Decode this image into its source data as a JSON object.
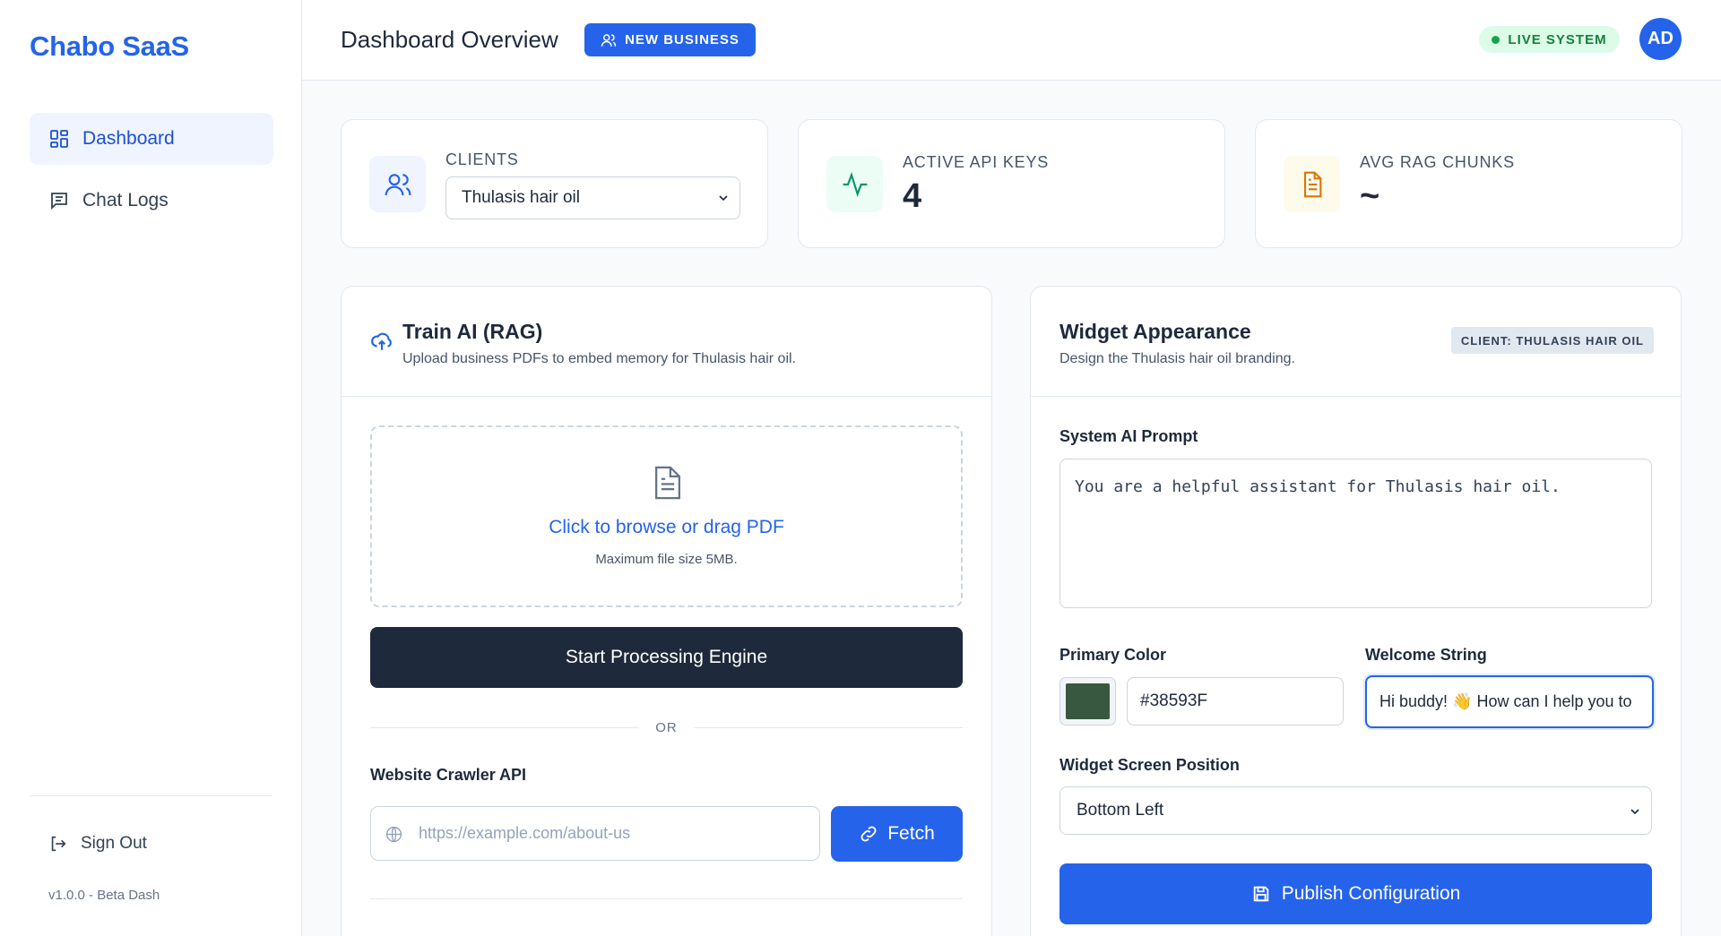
{
  "sidebar": {
    "brand": "Chabo SaaS",
    "items": [
      {
        "label": "Dashboard",
        "icon": "dashboard-grid-icon",
        "active": true
      },
      {
        "label": "Chat Logs",
        "icon": "chat-bubble-icon",
        "active": false
      }
    ],
    "signout_label": "Sign Out",
    "version": "v1.0.0 - Beta Dash"
  },
  "header": {
    "title": "Dashboard Overview",
    "new_business_label": "NEW BUSINESS",
    "status_label": "LIVE SYSTEM",
    "avatar_initials": "AD"
  },
  "stats": {
    "clients": {
      "label": "CLIENTS",
      "selected": "Thulasis hair oil"
    },
    "api_keys": {
      "label": "ACTIVE API KEYS",
      "value": "4"
    },
    "rag_chunks": {
      "label": "AVG RAG CHUNKS",
      "value": "~"
    }
  },
  "train": {
    "title": "Train AI (RAG)",
    "subtitle": "Upload business PDFs to embed memory for Thulasis hair oil.",
    "dropzone_title": "Click to browse or drag PDF",
    "dropzone_sub": "Maximum file size 5MB.",
    "process_label": "Start Processing Engine",
    "or_label": "OR",
    "crawler_label": "Website Crawler API",
    "url_placeholder": "https://example.com/about-us",
    "fetch_label": "Fetch"
  },
  "widget": {
    "title": "Widget Appearance",
    "subtitle": "Design the Thulasis hair oil branding.",
    "client_tag": "CLIENT: THULASIS HAIR OIL",
    "prompt_label": "System AI Prompt",
    "prompt_value": "You are a helpful assistant for Thulasis hair oil.",
    "color_label": "Primary Color",
    "color_value": "#38593F",
    "welcome_label": "Welcome String",
    "welcome_value": "Hi buddy! 👋 How can I help you to",
    "position_label": "Widget Screen Position",
    "position_value": "Bottom Left",
    "publish_label": "Publish Configuration"
  },
  "colors": {
    "accent": "#2563eb",
    "dark_button": "#1e293b",
    "live_green": "#16a34a",
    "swatch": "#38593F"
  }
}
